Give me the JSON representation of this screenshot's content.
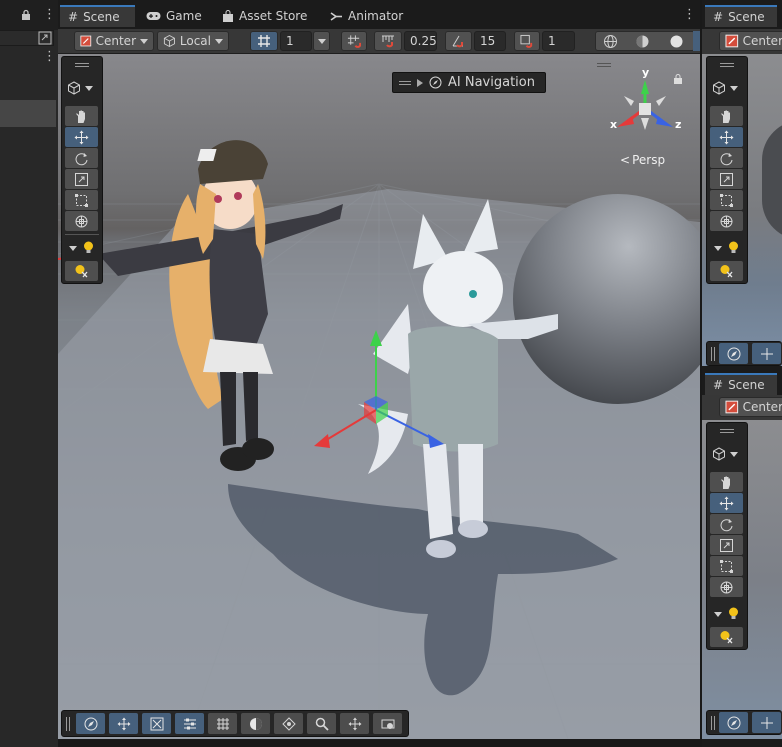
{
  "tabs": {
    "scene": "Scene",
    "game": "Game",
    "asset_store": "Asset Store",
    "animator": "Animator"
  },
  "toolbar": {
    "pivot": "Center",
    "space": "Local",
    "grid_value": "1",
    "snap_increment": "0.25",
    "rotate_snap": "15",
    "scale_snap": "1"
  },
  "overlay": {
    "ai_navigation": "AI Navigation",
    "camera_mode": "Persp"
  },
  "gizmo_axes": {
    "y": "y",
    "x": "x",
    "z": "z"
  },
  "right_top": {
    "tab": "Scene",
    "pivot": "Center"
  },
  "right_bottom": {
    "tab": "Scene",
    "pivot": "Center"
  },
  "tools": [
    "hand-tool",
    "move-tool",
    "rotate-tool",
    "scale-tool",
    "rect-tool",
    "transform-tool"
  ],
  "selected_tool": "move-tool",
  "colors": {
    "accent": "#3a79bb",
    "x_axis": "#e53a3a",
    "y_axis": "#3dd24a",
    "z_axis": "#3a63e3",
    "light_icon": "#f2c21a"
  }
}
